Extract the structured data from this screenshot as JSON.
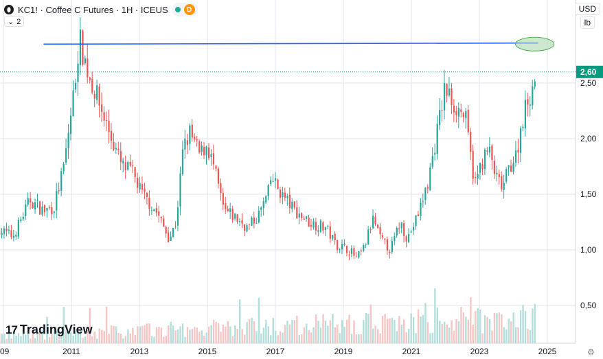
{
  "header": {
    "symbol_icon": "coffee-symbol-icon",
    "title": "KC1! · Coffee C Futures · 1H · ICEUS",
    "badge": "D",
    "collapse_count": "2"
  },
  "price_scale": {
    "currency": "USD",
    "unit": "lb",
    "last_price_label": "2,60"
  },
  "branding": {
    "logo_text": "TradingView"
  },
  "colors": {
    "up": "#26a69a",
    "down": "#ef5350",
    "trendline": "#2962ff",
    "highlight_fill": "#a5d6a7",
    "highlight_stroke": "#4caf50",
    "last_price_bg": "#089981"
  },
  "chart_data": {
    "type": "candlestick",
    "title": "Coffee C Futures",
    "y_axis": {
      "ticks": [
        "2,50",
        "2,00",
        "1,50",
        "1,00",
        "0,50"
      ],
      "tick_values": [
        2.5,
        2.0,
        1.5,
        1.0,
        0.5
      ],
      "range": [
        0.15,
        3.0
      ]
    },
    "x_axis": {
      "tick_labels": [
        "09",
        "2011",
        "2013",
        "2015",
        "2017",
        "2019",
        "2021",
        "2023",
        "2025"
      ],
      "tick_values": [
        2009,
        2011,
        2013,
        2015,
        2017,
        2019,
        2021,
        2023,
        2025
      ],
      "range": [
        2008.9,
        2025.6
      ]
    },
    "price_path": [
      [
        2008.9,
        1.18
      ],
      [
        2009.3,
        1.12
      ],
      [
        2009.8,
        1.45
      ],
      [
        2010.2,
        1.35
      ],
      [
        2010.5,
        1.38
      ],
      [
        2010.8,
        1.75
      ],
      [
        2011.1,
        2.45
      ],
      [
        2011.25,
        2.9
      ],
      [
        2011.5,
        2.6
      ],
      [
        2011.8,
        2.35
      ],
      [
        2012.2,
        2.0
      ],
      [
        2012.5,
        1.75
      ],
      [
        2012.8,
        1.7
      ],
      [
        2013.1,
        1.5
      ],
      [
        2013.5,
        1.35
      ],
      [
        2013.9,
        1.1
      ],
      [
        2014.1,
        1.25
      ],
      [
        2014.3,
        1.9
      ],
      [
        2014.5,
        2.05
      ],
      [
        2014.8,
        1.85
      ],
      [
        2015.0,
        1.95
      ],
      [
        2015.2,
        1.75
      ],
      [
        2015.5,
        1.35
      ],
      [
        2015.8,
        1.3
      ],
      [
        2016.2,
        1.2
      ],
      [
        2016.5,
        1.3
      ],
      [
        2016.8,
        1.5
      ],
      [
        2016.9,
        1.65
      ],
      [
        2017.2,
        1.5
      ],
      [
        2017.6,
        1.35
      ],
      [
        2018.0,
        1.25
      ],
      [
        2018.5,
        1.2
      ],
      [
        2018.8,
        1.05
      ],
      [
        2019.2,
        1.0
      ],
      [
        2019.4,
        0.92
      ],
      [
        2019.6,
        1.0
      ],
      [
        2019.9,
        1.28
      ],
      [
        2020.1,
        1.1
      ],
      [
        2020.4,
        1.0
      ],
      [
        2020.7,
        1.25
      ],
      [
        2020.9,
        1.1
      ],
      [
        2021.2,
        1.3
      ],
      [
        2021.5,
        1.6
      ],
      [
        2021.8,
        2.1
      ],
      [
        2022.0,
        2.45
      ],
      [
        2022.3,
        2.3
      ],
      [
        2022.6,
        2.2
      ],
      [
        2022.8,
        1.75
      ],
      [
        2022.9,
        1.6
      ],
      [
        2023.1,
        1.8
      ],
      [
        2023.3,
        1.9
      ],
      [
        2023.5,
        1.65
      ],
      [
        2023.7,
        1.55
      ],
      [
        2023.9,
        1.75
      ],
      [
        2024.1,
        1.85
      ],
      [
        2024.3,
        2.2
      ],
      [
        2024.5,
        2.4
      ],
      [
        2024.7,
        2.6
      ]
    ],
    "trendline": {
      "from": [
        2010.2,
        2.85
      ],
      "to": [
        2024.75,
        2.86
      ]
    },
    "highlight_ellipse_center": [
      2024.65,
      2.85
    ],
    "last_price": 2.6,
    "volume_profile": "ascending bars along bottom, larger in 2019-2024"
  }
}
